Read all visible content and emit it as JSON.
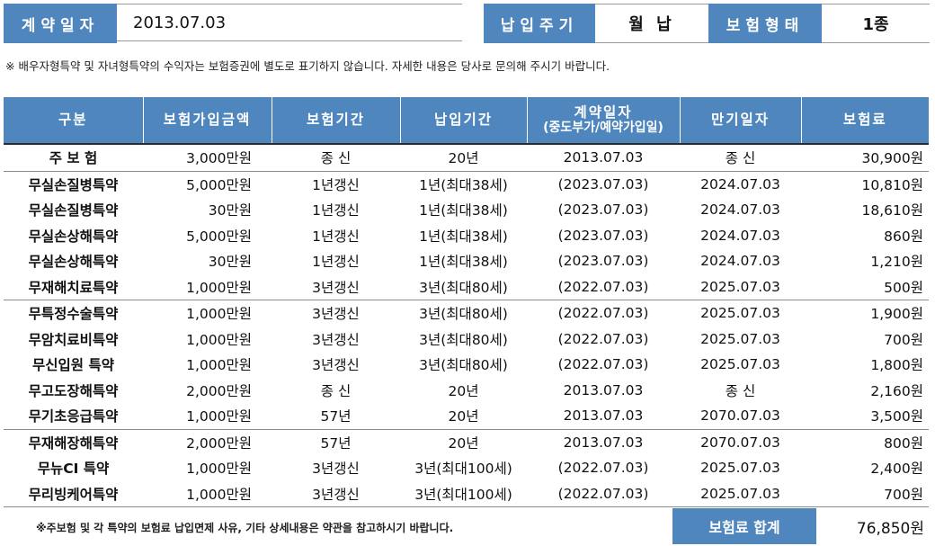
{
  "header": {
    "contract_date_label": "계약일자",
    "contract_date_value": "2013.07.03",
    "payment_cycle_label": "납입주기",
    "payment_cycle_value": "월 납",
    "insurance_type_label": "보험형태",
    "insurance_type_value": "1종"
  },
  "notice": "※ 배우자형특약 및 자녀형특약의 수익자는 보험증권에 별도로 표기하지 않습니다. 자세한 내용은 당사로 문의해 주시기 바랍니다.",
  "table": {
    "columns": [
      "구분",
      "보험가입금액",
      "보험기간",
      "납입기간",
      "계약일자",
      "만기일자",
      "보험료"
    ],
    "contract_date_sub": "(중도부가/예약가입일)",
    "rows": [
      [
        "주 보 험",
        "3,000만원",
        "종   신",
        "20년",
        "2013.07.03",
        "종   신",
        "30,900원"
      ],
      [
        "무실손질병특약",
        "5,000만원",
        "1년갱신",
        "1년(최대38세)",
        "(2023.07.03)",
        "2024.07.03",
        "10,810원"
      ],
      [
        "무실손질병특약",
        "30만원",
        "1년갱신",
        "1년(최대38세)",
        "(2023.07.03)",
        "2024.07.03",
        "18,610원"
      ],
      [
        "무실손상해특약",
        "5,000만원",
        "1년갱신",
        "1년(최대38세)",
        "(2023.07.03)",
        "2024.07.03",
        "860원"
      ],
      [
        "무실손상해특약",
        "30만원",
        "1년갱신",
        "1년(최대38세)",
        "(2023.07.03)",
        "2024.07.03",
        "1,210원"
      ],
      [
        "무재해치료특약",
        "1,000만원",
        "3년갱신",
        "3년(최대80세)",
        "(2022.07.03)",
        "2025.07.03",
        "500원"
      ],
      [
        "무특정수술특약",
        "1,000만원",
        "3년갱신",
        "3년(최대80세)",
        "(2022.07.03)",
        "2025.07.03",
        "1,900원"
      ],
      [
        "무암치료비특약",
        "1,000만원",
        "3년갱신",
        "3년(최대80세)",
        "(2022.07.03)",
        "2025.07.03",
        "700원"
      ],
      [
        "무신입원 특약",
        "1,000만원",
        "3년갱신",
        "3년(최대80세)",
        "(2022.07.03)",
        "2025.07.03",
        "1,800원"
      ],
      [
        "무고도장해특약",
        "2,000만원",
        "종   신",
        "20년",
        "2013.07.03",
        "종   신",
        "2,160원"
      ],
      [
        "무기초응급특약",
        "1,000만원",
        "57년",
        "20년",
        "2013.07.03",
        "2070.07.03",
        "3,500원"
      ],
      [
        "무재해장해특약",
        "2,000만원",
        "57년",
        "20년",
        "2013.07.03",
        "2070.07.03",
        "800원"
      ],
      [
        "무뉴CI 특약",
        "1,000만원",
        "3년갱신",
        "3년(최대100세)",
        "(2022.07.03)",
        "2025.07.03",
        "2,400원"
      ],
      [
        "무리빙케어특약",
        "1,000만원",
        "3년갱신",
        "3년(최대100세)",
        "(2022.07.03)",
        "2025.07.03",
        "700원"
      ]
    ]
  },
  "footer": {
    "note": "※주보험 및 각 특약의 보험료 납입면제 사유, 기타 상세내용은 약관을 참고하시기 바랍니다.",
    "total_label": "보험료 합계",
    "total_value": "76,850원"
  }
}
